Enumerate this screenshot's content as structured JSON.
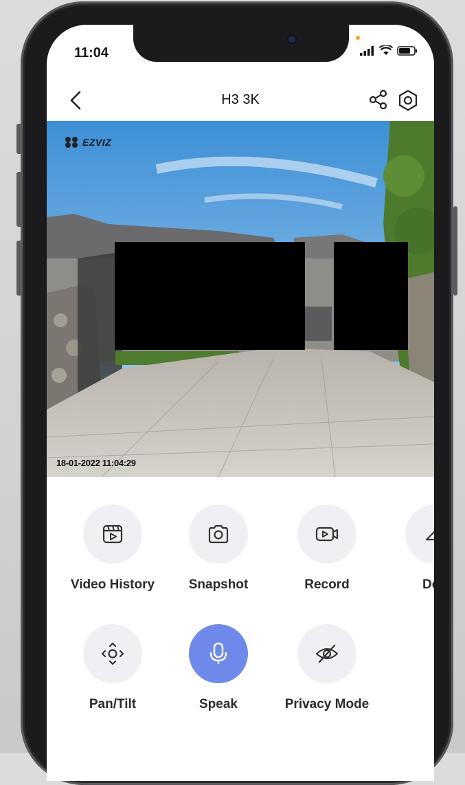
{
  "status_bar": {
    "time": "11:04"
  },
  "nav": {
    "title": "H3 3K",
    "back_icon": "chevron-left-icon",
    "share_icon": "share-icon",
    "settings_icon": "gear-icon"
  },
  "video": {
    "brand": "EZVIZ",
    "timestamp": "18-01-2022 11:04:29"
  },
  "controls": [
    {
      "label": "Video History",
      "icon": "video-history-icon"
    },
    {
      "label": "Snapshot",
      "icon": "camera-icon"
    },
    {
      "label": "Record",
      "icon": "video-record-icon"
    },
    {
      "label": "Defi",
      "icon": "definition-icon"
    },
    {
      "label": "Pan/Tilt",
      "icon": "pan-tilt-icon"
    },
    {
      "label": "Speak",
      "icon": "microphone-icon",
      "active": true
    },
    {
      "label": "Privacy Mode",
      "icon": "eye-off-icon"
    }
  ],
  "colors": {
    "accent": "#6f89ea",
    "button_bg": "#eef0f4",
    "frame": "#1b1b1d"
  }
}
